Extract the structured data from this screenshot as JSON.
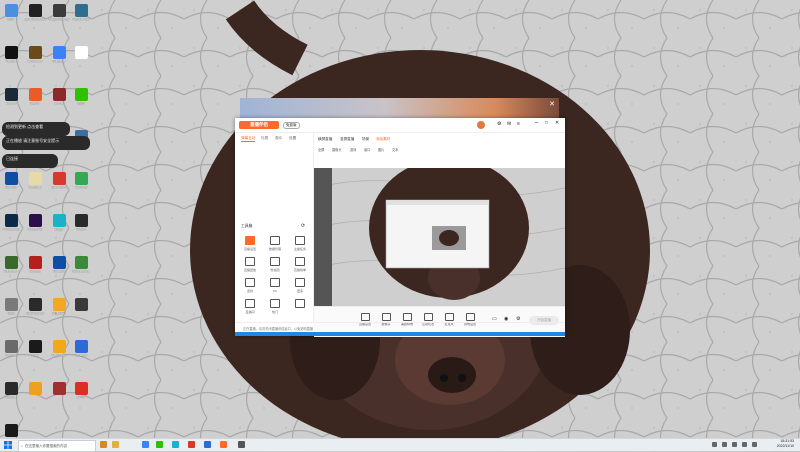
{
  "desktop_icons": [
    {
      "label": "图片",
      "color": "#4a90e2"
    },
    {
      "label": "Epic Games Launcher",
      "color": "#222222"
    },
    {
      "label": "Magic Survey",
      "color": "#3b3b3b"
    },
    {
      "label": "Aeolus Bot",
      "color": "#2f6e8e"
    },
    {
      "label": "Notion",
      "color": "#111111"
    },
    {
      "label": "Unknown",
      "color": "#6a4a1a"
    },
    {
      "label": "Snipaste",
      "color": "#3b82f6"
    },
    {
      "label": "",
      "color": "#ffffff"
    },
    {
      "label": "Steam",
      "color": "#1b2838"
    },
    {
      "label": "Bilibili",
      "color": "#e85b2a"
    },
    {
      "label": "Lords",
      "color": "#8a2a2a"
    },
    {
      "label": "微信",
      "color": "#2dc100"
    },
    {
      "label": "QQ",
      "color": "#2e9bf0"
    },
    {
      "label": "Wallpaper",
      "color": "#1c7bd6"
    },
    {
      "label": "此电脑",
      "color": "#4a90e2"
    },
    {
      "label": "控制面板",
      "color": "#3a6ea5"
    },
    {
      "label": "Outlook",
      "color": "#0e4fa3"
    },
    {
      "label": "Genshin",
      "color": "#e8d9a8"
    },
    {
      "label": "Bandicam",
      "color": "#d53a2a"
    },
    {
      "label": "Chrome",
      "color": "#34a853"
    },
    {
      "label": "Photoshop",
      "color": "#0b2a4a"
    },
    {
      "label": "Adobe AE",
      "color": "#2a0f4a"
    },
    {
      "label": "Edge",
      "color": "#1db0c9"
    },
    {
      "label": "Cloud",
      "color": "#2a2a2a"
    },
    {
      "label": "Minecraft",
      "color": "#3a6a2a"
    },
    {
      "label": "Acrobat",
      "color": "#b2211a"
    },
    {
      "label": "Outlook",
      "color": "#0e4fa3"
    },
    {
      "label": "Bluestacks",
      "color": "#3a8a3a"
    },
    {
      "label": "Orbit",
      "color": "#7a7a7a"
    },
    {
      "label": "OBS Studio",
      "color": "#2a2a2a"
    },
    {
      "label": "直播伴侣",
      "color": "#f5a623"
    },
    {
      "label": "",
      "color": "#3a3a3a"
    },
    {
      "label": "Photos",
      "color": "#6a6a6a"
    },
    {
      "label": "剪映",
      "color": "#1a1a1a"
    },
    {
      "label": "FL Studio",
      "color": "#f2a81a"
    },
    {
      "label": "Tencent",
      "color": "#2e6ad6"
    },
    {
      "label": "Oculus",
      "color": "#2a2a2a"
    },
    {
      "label": "",
      "color": "#f0a020"
    },
    {
      "label": "",
      "color": "#a03030"
    },
    {
      "label": "WPS",
      "color": "#d93025"
    },
    {
      "label": "OBS",
      "color": "#1a1a1a"
    }
  ],
  "toasts": [
    "检测到更新 点击查看",
    "正在播放 请注意账号安全提示",
    "已连接"
  ],
  "app": {
    "logo": "直播伴侣",
    "badge": "免费版",
    "sidebar_tabs": [
      "弹幕互动",
      "礼物",
      "观众",
      "设置"
    ],
    "tools_title": "工具箱",
    "tools": [
      {
        "label": "直播设置",
        "hot": true
      },
      {
        "label": "数据管理",
        "hot": false
      },
      {
        "label": "主播任务",
        "hot": false
      },
      {
        "label": "直播回放",
        "hot": false
      },
      {
        "label": "粉丝团",
        "hot": false
      },
      {
        "label": "直播榜单",
        "hot": false
      },
      {
        "label": "连线",
        "hot": false
      },
      {
        "label": "PK",
        "hot": false
      },
      {
        "label": "更多",
        "hot": false
      },
      {
        "label": "直播间",
        "hot": false
      },
      {
        "label": "热门",
        "hot": false
      },
      {
        "label": "",
        "hot": false
      }
    ],
    "scene_tabs": [
      "横屏直播",
      "竖屏直播",
      "场景",
      "添加素材"
    ],
    "scene_row2": [
      "全屏",
      "摄像头",
      "游戏",
      "窗口",
      "图片",
      "文本"
    ],
    "controls": [
      "直播设置",
      "摄像头",
      "美颜特效",
      "互动玩法",
      "麦克风",
      "音效设置"
    ],
    "start_button": "开始直播",
    "status": "正在直播，请勿关闭直播伴侣窗口，以免影响直播"
  },
  "taskbar": {
    "search_placeholder": "在这里输入你要搜索的内容",
    "time": "18:31:53",
    "date": "2022/11/10"
  }
}
